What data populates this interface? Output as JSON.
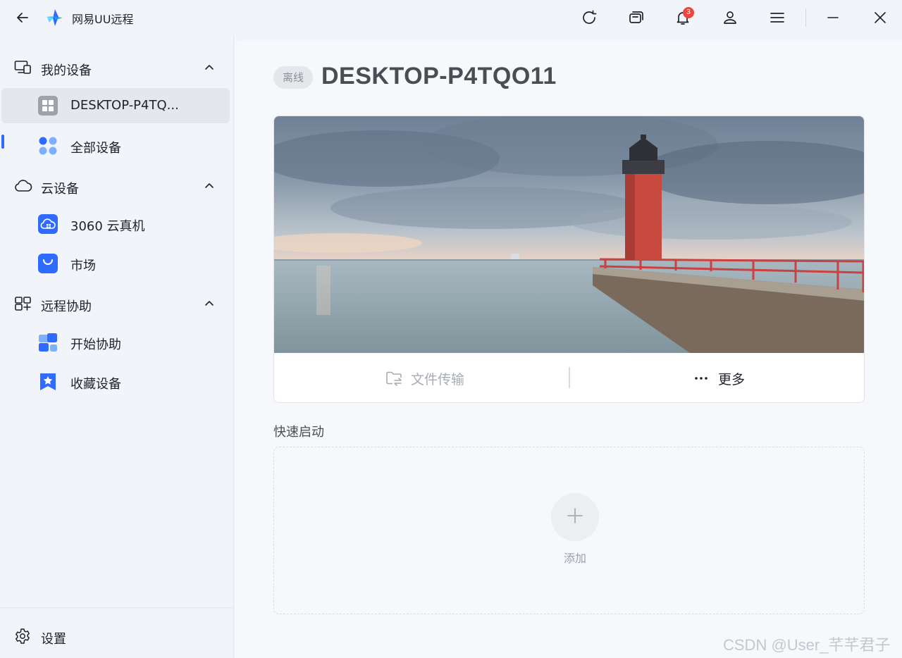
{
  "app": {
    "title": "网易UU远程"
  },
  "titlebar": {
    "notification_count": "3"
  },
  "sidebar": {
    "groups": [
      {
        "label": "我的设备",
        "items": [
          {
            "label": "DESKTOP-P4TQ...",
            "icon": "windows-icon",
            "active": true
          },
          {
            "label": "全部设备",
            "icon": "grid-dots-icon"
          }
        ]
      },
      {
        "label": "云设备",
        "items": [
          {
            "label": "3060 云真机",
            "icon": "cloud-machine-icon"
          },
          {
            "label": "市场",
            "icon": "shopping-bag-icon"
          }
        ]
      },
      {
        "label": "远程协助",
        "items": [
          {
            "label": "开始协助",
            "icon": "assist-icon"
          },
          {
            "label": "收藏设备",
            "icon": "bookmark-star-icon"
          }
        ]
      }
    ],
    "settings_label": "设置"
  },
  "main": {
    "status": "离线",
    "device_name": "DESKTOP-P4TQO11",
    "actions": {
      "file_transfer": "文件传输",
      "more": "更多"
    },
    "quick_start_label": "快速启动",
    "add_label": "添加"
  },
  "colors": {
    "accent": "#2f6bff",
    "badge": "#f0443c"
  },
  "watermark": "CSDN @User_芊芊君子"
}
